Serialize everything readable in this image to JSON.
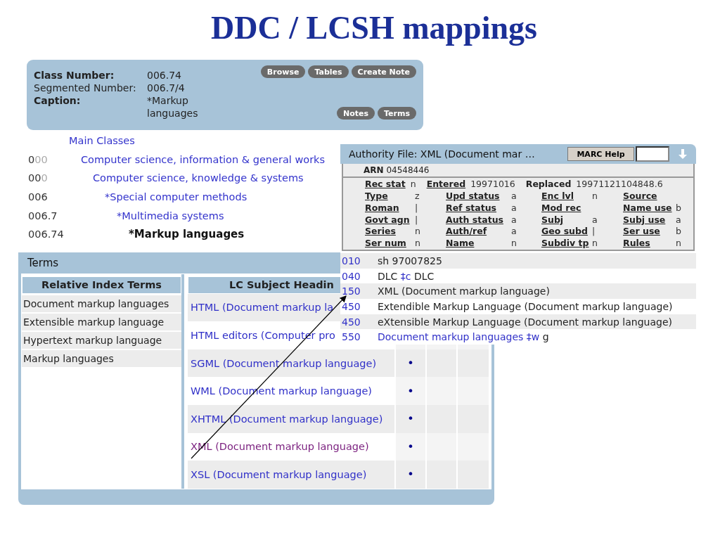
{
  "slide_title": "DDC / LCSH mappings",
  "class_panel": {
    "fields": [
      {
        "label": "Class Number:",
        "value": "006.74",
        "bold": true
      },
      {
        "label": "Segmented Number:",
        "value": "006.7/4",
        "bold": false
      },
      {
        "label": "Caption:",
        "value": "*Markup languages",
        "bold": true
      }
    ],
    "buttons": [
      "Browse",
      "Tables",
      "Create Note"
    ],
    "lower_buttons": [
      "Notes",
      "Terms"
    ]
  },
  "hierarchy": {
    "label": "Main Classes",
    "current": false,
    "children": [
      {
        "code": "0",
        "code_faded": "00",
        "label": "Computer science, information & general works",
        "current": false,
        "children": [
          {
            "code": "00",
            "code_faded": "0",
            "label": "Computer science, knowledge & systems",
            "current": false,
            "children": [
              {
                "code": "006",
                "label": "*Special computer methods",
                "current": false,
                "children": [
                  {
                    "code": "006.7",
                    "label": "*Multimedia systems",
                    "current": false,
                    "children": [
                      {
                        "code": "006.74",
                        "label": "*Markup languages",
                        "current": true
                      }
                    ]
                  }
                ]
              }
            ]
          }
        ]
      }
    ]
  },
  "terms_panel": {
    "title": "Terms",
    "relative_index": {
      "heading": "Relative Index Terms",
      "rows": [
        "Document markup languages",
        "Extensible markup language",
        "Hypertext markup language",
        "Markup languages"
      ]
    },
    "lc_subjects": {
      "heading": "LC Subject Headin",
      "rows": [
        {
          "text": "HTML (Document markup la",
          "visited": false
        },
        {
          "text": "HTML editors (Computer pro",
          "visited": false
        },
        {
          "text": "SGML (Document markup language)",
          "visited": false,
          "mark": "•"
        },
        {
          "text": "WML (Document markup language)",
          "visited": false,
          "mark": "•"
        },
        {
          "text": "XHTML (Document markup language)",
          "visited": false,
          "mark": "•"
        },
        {
          "text": "XML (Document markup language)",
          "visited": true,
          "mark": "•"
        },
        {
          "text": "XSL (Document markup language)",
          "visited": false,
          "mark": "•"
        }
      ]
    }
  },
  "authority_popup": {
    "title": "Authority File: XML (Document mar …",
    "help_button": "MARC Help",
    "arn_label": "ARN",
    "arn": "04548446",
    "dates": [
      {
        "label": "Rec stat",
        "value": "n",
        "link": true
      },
      {
        "label": "Entered",
        "value": "19971016",
        "link": true
      },
      {
        "label": "Replaced",
        "value": "19971121104848.6",
        "link": false
      }
    ],
    "codes": [
      [
        {
          "label": "Type",
          "value": "z"
        },
        {
          "label": "Upd status",
          "value": "a"
        },
        {
          "label": "Enc lvl",
          "value": "n"
        },
        {
          "label": "Source"
        }
      ],
      [
        {
          "label": "Roman",
          "value": "|"
        },
        {
          "label": "Ref status",
          "value": "a"
        },
        {
          "label": "Mod rec"
        },
        {
          "label": "Name use",
          "value": "b"
        }
      ],
      [
        {
          "label": "Govt agn",
          "value": "|"
        },
        {
          "label": "Auth status",
          "value": "a"
        },
        {
          "label": "Subj",
          "value": "a"
        },
        {
          "label": "Subj use",
          "value": "a"
        }
      ],
      [
        {
          "label": "Series",
          "value": "n"
        },
        {
          "label": "Auth/ref",
          "value": "a"
        },
        {
          "label": "Geo subd",
          "value": "|"
        },
        {
          "label": "Ser use",
          "value": "b"
        }
      ],
      [
        {
          "label": "Ser num",
          "value": "n"
        },
        {
          "label": "Name",
          "value": "n"
        },
        {
          "label": "Subdiv tp",
          "value": "n"
        },
        {
          "label": "Rules",
          "value": "n"
        }
      ]
    ],
    "fields": [
      {
        "tag": "010",
        "segments": [
          {
            "kind": "text",
            "text": "sh 97007825"
          }
        ]
      },
      {
        "tag": "040",
        "segments": [
          {
            "kind": "text",
            "text": "DLC"
          },
          {
            "kind": "subfield",
            "text": "‡c"
          },
          {
            "kind": "text",
            "text": "DLC"
          }
        ]
      },
      {
        "tag": "150",
        "segments": [
          {
            "kind": "text",
            "text": "XML (Document markup language)"
          }
        ]
      },
      {
        "tag": "450",
        "segments": [
          {
            "kind": "text",
            "text": "Extendible Markup Language (Document markup language)"
          }
        ]
      },
      {
        "tag": "450",
        "segments": [
          {
            "kind": "text",
            "text": "eXtensible Markup Language (Document markup language)"
          }
        ]
      },
      {
        "tag": "550",
        "segments": [
          {
            "kind": "link",
            "text": "Document markup languages ‡w"
          },
          {
            "kind": "text",
            "text": "g"
          }
        ]
      }
    ]
  }
}
